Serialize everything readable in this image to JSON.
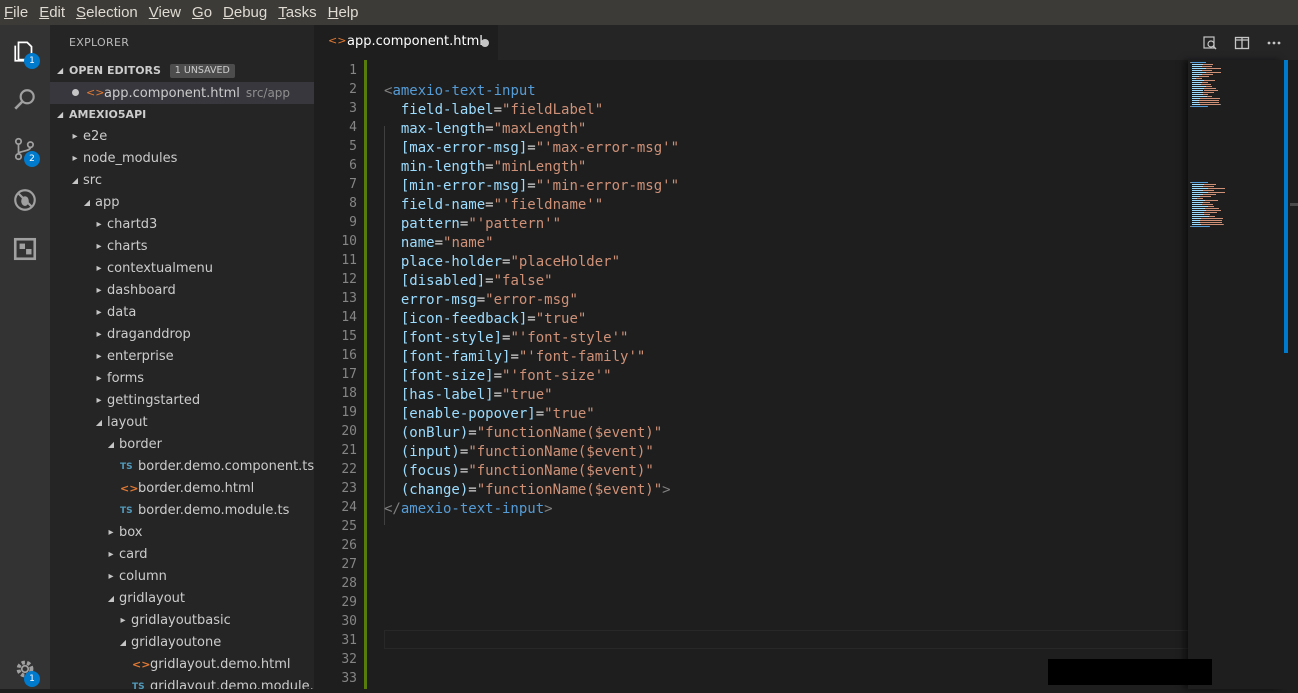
{
  "menu": {
    "items": [
      {
        "u": "F",
        "rest": "ile"
      },
      {
        "u": "E",
        "rest": "dit"
      },
      {
        "u": "S",
        "rest": "election"
      },
      {
        "u": "V",
        "rest": "iew"
      },
      {
        "u": "G",
        "rest": "o"
      },
      {
        "u": "D",
        "rest": "ebug"
      },
      {
        "u": "T",
        "rest": "asks"
      },
      {
        "u": "H",
        "rest": "elp"
      }
    ]
  },
  "activity": {
    "icons": [
      "files-icon",
      "search-icon",
      "source-control-icon",
      "debug-icon",
      "extensions-icon",
      "gear-icon"
    ],
    "badges": {
      "explorer": "1",
      "scm": "2",
      "settings": "1"
    }
  },
  "sidebar": {
    "title": "EXPLORER",
    "open_editors": {
      "header": "OPEN EDITORS",
      "badge": "1 UNSAVED",
      "file": {
        "name": "app.component.html",
        "path": "src/app"
      }
    },
    "project": {
      "header": "AMEXIO5API",
      "tree": [
        {
          "label": "e2e",
          "depth": 0,
          "kind": "folder",
          "open": false
        },
        {
          "label": "node_modules",
          "depth": 0,
          "kind": "folder",
          "open": false
        },
        {
          "label": "src",
          "depth": 0,
          "kind": "folder",
          "open": true
        },
        {
          "label": "app",
          "depth": 1,
          "kind": "folder",
          "open": true
        },
        {
          "label": "chartd3",
          "depth": 2,
          "kind": "folder",
          "open": false
        },
        {
          "label": "charts",
          "depth": 2,
          "kind": "folder",
          "open": false
        },
        {
          "label": "contextualmenu",
          "depth": 2,
          "kind": "folder",
          "open": false
        },
        {
          "label": "dashboard",
          "depth": 2,
          "kind": "folder",
          "open": false
        },
        {
          "label": "data",
          "depth": 2,
          "kind": "folder",
          "open": false
        },
        {
          "label": "draganddrop",
          "depth": 2,
          "kind": "folder",
          "open": false
        },
        {
          "label": "enterprise",
          "depth": 2,
          "kind": "folder",
          "open": false
        },
        {
          "label": "forms",
          "depth": 2,
          "kind": "folder",
          "open": false
        },
        {
          "label": "gettingstarted",
          "depth": 2,
          "kind": "folder",
          "open": false
        },
        {
          "label": "layout",
          "depth": 2,
          "kind": "folder",
          "open": true
        },
        {
          "label": "border",
          "depth": 3,
          "kind": "folder",
          "open": true
        },
        {
          "label": "border.demo.component.ts",
          "depth": 4,
          "kind": "ts"
        },
        {
          "label": "border.demo.html",
          "depth": 4,
          "kind": "html"
        },
        {
          "label": "border.demo.module.ts",
          "depth": 4,
          "kind": "ts"
        },
        {
          "label": "box",
          "depth": 3,
          "kind": "folder",
          "open": false
        },
        {
          "label": "card",
          "depth": 3,
          "kind": "folder",
          "open": false
        },
        {
          "label": "column",
          "depth": 3,
          "kind": "folder",
          "open": false
        },
        {
          "label": "gridlayout",
          "depth": 3,
          "kind": "folder",
          "open": true
        },
        {
          "label": "gridlayoutbasic",
          "depth": 4,
          "kind": "folder",
          "open": false
        },
        {
          "label": "gridlayoutone",
          "depth": 4,
          "kind": "folder",
          "open": true
        },
        {
          "label": "gridlayout.demo.html",
          "depth": 5,
          "kind": "html"
        },
        {
          "label": "gridlayout.demo.module.ts",
          "depth": 5,
          "kind": "ts"
        }
      ]
    }
  },
  "editor": {
    "tab": {
      "name": "app.component.html",
      "icon": "html-file-icon"
    },
    "line_count": 33,
    "lines": [
      [],
      [
        [
          "p",
          "<"
        ],
        [
          "tg",
          "amexio-text-input"
        ]
      ],
      [
        [
          "df",
          "  "
        ],
        [
          "at",
          "field-label"
        ],
        [
          "df",
          "="
        ],
        [
          "st",
          "\"fieldLabel\""
        ]
      ],
      [
        [
          "df",
          "  "
        ],
        [
          "at",
          "max-length"
        ],
        [
          "df",
          "="
        ],
        [
          "st",
          "\"maxLength\""
        ]
      ],
      [
        [
          "df",
          "  "
        ],
        [
          "at",
          "[max-error-msg]"
        ],
        [
          "df",
          "="
        ],
        [
          "st",
          "\"'max-error-msg'\""
        ]
      ],
      [
        [
          "df",
          "  "
        ],
        [
          "at",
          "min-length"
        ],
        [
          "df",
          "="
        ],
        [
          "st",
          "\"minLength\""
        ]
      ],
      [
        [
          "df",
          "  "
        ],
        [
          "at",
          "[min-error-msg]"
        ],
        [
          "df",
          "="
        ],
        [
          "st",
          "\"'min-error-msg'\""
        ]
      ],
      [
        [
          "df",
          "  "
        ],
        [
          "at",
          "field-name"
        ],
        [
          "df",
          "="
        ],
        [
          "st",
          "\"'fieldname'\""
        ]
      ],
      [
        [
          "df",
          "  "
        ],
        [
          "at",
          "pattern"
        ],
        [
          "df",
          "="
        ],
        [
          "st",
          "\"'pattern'\""
        ]
      ],
      [
        [
          "df",
          "  "
        ],
        [
          "at",
          "name"
        ],
        [
          "df",
          "="
        ],
        [
          "st",
          "\"name\""
        ]
      ],
      [
        [
          "df",
          "  "
        ],
        [
          "at",
          "place-holder"
        ],
        [
          "df",
          "="
        ],
        [
          "st",
          "\"placeHolder\""
        ]
      ],
      [
        [
          "df",
          "  "
        ],
        [
          "at",
          "[disabled]"
        ],
        [
          "df",
          "="
        ],
        [
          "st",
          "\"false\""
        ]
      ],
      [
        [
          "df",
          "  "
        ],
        [
          "at",
          "error-msg"
        ],
        [
          "df",
          "="
        ],
        [
          "st",
          "\"error-msg\""
        ]
      ],
      [
        [
          "df",
          "  "
        ],
        [
          "at",
          "[icon-feedback]"
        ],
        [
          "df",
          "="
        ],
        [
          "st",
          "\"true\""
        ]
      ],
      [
        [
          "df",
          "  "
        ],
        [
          "at",
          "[font-style]"
        ],
        [
          "df",
          "="
        ],
        [
          "st",
          "\"'font-style'\""
        ]
      ],
      [
        [
          "df",
          "  "
        ],
        [
          "at",
          "[font-family]"
        ],
        [
          "df",
          "="
        ],
        [
          "st",
          "\"'font-family'\""
        ]
      ],
      [
        [
          "df",
          "  "
        ],
        [
          "at",
          "[font-size]"
        ],
        [
          "df",
          "="
        ],
        [
          "st",
          "\"'font-size'\""
        ]
      ],
      [
        [
          "df",
          "  "
        ],
        [
          "at",
          "[has-label]"
        ],
        [
          "df",
          "="
        ],
        [
          "st",
          "\"true\""
        ]
      ],
      [
        [
          "df",
          "  "
        ],
        [
          "at",
          "[enable-popover]"
        ],
        [
          "df",
          "="
        ],
        [
          "st",
          "\"true\""
        ]
      ],
      [
        [
          "df",
          "  "
        ],
        [
          "at",
          "(onBlur)"
        ],
        [
          "df",
          "="
        ],
        [
          "st",
          "\"functionName($event)\""
        ]
      ],
      [
        [
          "df",
          "  "
        ],
        [
          "at",
          "(input)"
        ],
        [
          "df",
          "="
        ],
        [
          "st",
          "\"functionName($event)\""
        ]
      ],
      [
        [
          "df",
          "  "
        ],
        [
          "at",
          "(focus)"
        ],
        [
          "df",
          "="
        ],
        [
          "st",
          "\"functionName($event)\""
        ]
      ],
      [
        [
          "df",
          "  "
        ],
        [
          "at",
          "(change)"
        ],
        [
          "df",
          "="
        ],
        [
          "st",
          "\"functionName($event)\""
        ],
        [
          "p",
          ">"
        ]
      ],
      [
        [
          "p",
          "</"
        ],
        [
          "tg",
          "amexio-text-input"
        ],
        [
          "p",
          ">"
        ]
      ],
      [],
      [],
      [],
      [],
      [],
      [],
      [],
      [],
      []
    ]
  },
  "colors": {
    "accent": "#007acc",
    "modified": "#587c0c"
  }
}
